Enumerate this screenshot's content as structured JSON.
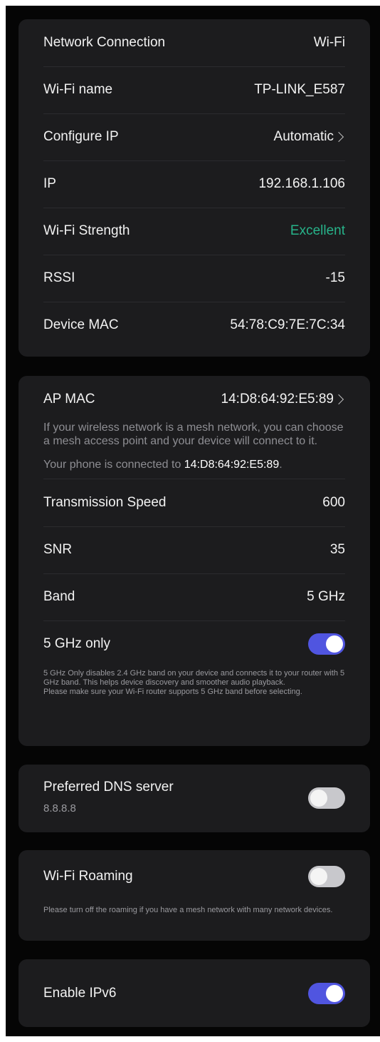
{
  "colors": {
    "background": "#050505",
    "card": "#1c1c1e",
    "accent": "#5055e0",
    "excellent": "#27b38a"
  },
  "connection_card": {
    "rows": [
      {
        "label": "Network Connection",
        "value": "Wi-Fi"
      },
      {
        "label": "Wi-Fi name",
        "value": "TP-LINK_E587"
      },
      {
        "label": "Configure IP",
        "value": "Automatic",
        "icon": "chevron-right-icon"
      },
      {
        "label": "IP",
        "value": "192.168.1.106"
      },
      {
        "label": "Wi-Fi Strength",
        "value": "Excellent"
      },
      {
        "label": "RSSI",
        "value": "-15"
      },
      {
        "label": "Device MAC",
        "value": "54:78:C9:7E:7C:34"
      }
    ]
  },
  "ap_card": {
    "ap_mac_label": "AP MAC",
    "ap_mac_value": "14:D8:64:92:E5:89",
    "ap_mac_icon": "chevron-right-icon",
    "mesh_description": "If your wireless network is a mesh network, you can choose a mesh access point and your device will connect to it.",
    "connected_prefix": "Your phone is connected to ",
    "connected_mac": "14:D8:64:92:E5:89",
    "connected_suffix": ".",
    "rows": [
      {
        "label": "Transmission Speed",
        "value": "600"
      },
      {
        "label": "SNR",
        "value": "35"
      },
      {
        "label": "Band",
        "value": "5 GHz"
      }
    ],
    "five_ghz_only": {
      "label": "5 GHz only",
      "enabled": true,
      "note_line1": "5 GHz Only disables 2.4 GHz band on your device and connects it to your router with 5 GHz band. This helps device discovery and smoother audio playback.",
      "note_line2": "Please make sure your Wi-Fi router supports 5 GHz band before selecting."
    }
  },
  "dns_card": {
    "label": "Preferred DNS server",
    "value": "8.8.8.8",
    "enabled": false
  },
  "roaming_card": {
    "label": "Wi-Fi Roaming",
    "enabled": false,
    "note": "Please turn off the roaming if you have a mesh network with many network devices."
  },
  "ipv6_card": {
    "label": "Enable IPv6",
    "enabled": true
  }
}
